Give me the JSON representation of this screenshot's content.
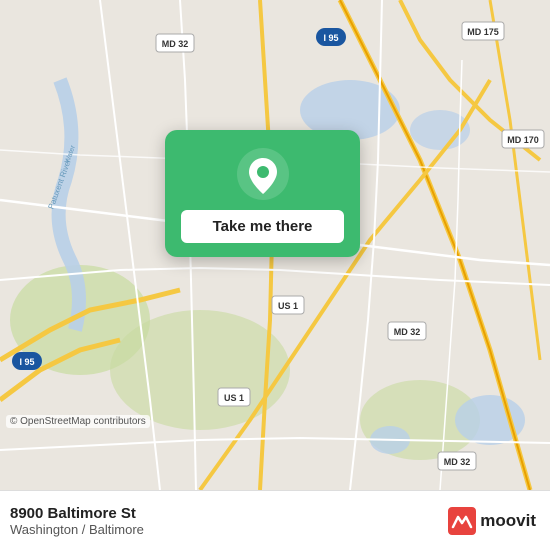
{
  "map": {
    "background_color": "#e8e0d8"
  },
  "popup": {
    "button_label": "Take me there",
    "pin_icon": "location-pin-icon"
  },
  "bottom_bar": {
    "address": "8900 Baltimore St",
    "city": "Washington / Baltimore",
    "copyright": "© OpenStreetMap contributors",
    "logo_text": "moovit"
  },
  "colors": {
    "green": "#3dba6f",
    "white": "#ffffff",
    "moovit_red": "#e8433e"
  }
}
